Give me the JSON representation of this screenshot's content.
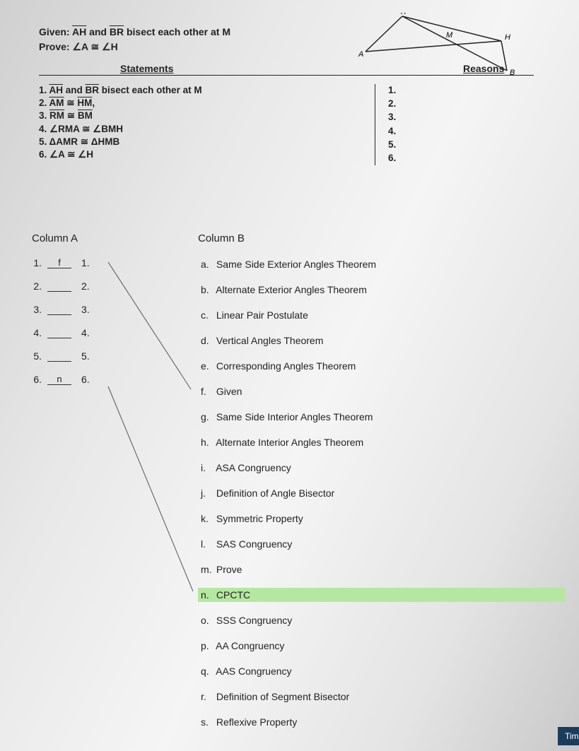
{
  "given_label": "Given:",
  "given_text_prefix": " ",
  "given_ah": "AH",
  "given_and": " and ",
  "given_br": "BR",
  "given_rest": " bisect each other at M",
  "prove_label": "Prove:",
  "prove_text": " ∠A ≅ ∠H",
  "diagram": {
    "R": "R",
    "A": "A",
    "M": "M",
    "H": "H",
    "B": "B"
  },
  "headers": {
    "statements": "Statements",
    "reasons": "Reasons"
  },
  "statements": [
    {
      "n": "1.",
      "pre": "",
      "seg1": "AH",
      "mid": " and ",
      "seg2": "BR",
      "post": " bisect each other at M"
    },
    {
      "n": "2.",
      "pre": "",
      "seg1": "AM",
      "mid": " ≅ ",
      "seg2": "HM",
      "post": ","
    },
    {
      "n": "3.",
      "pre": "",
      "seg1": "RM",
      "mid": " ≅ ",
      "seg2": "BM",
      "post": ""
    },
    {
      "n": "4.",
      "pre": "∠RMA ≅ ∠BMH",
      "seg1": "",
      "mid": "",
      "seg2": "",
      "post": ""
    },
    {
      "n": "5.",
      "pre": "ΔAMR ≅ ΔHMB",
      "seg1": "",
      "mid": "",
      "seg2": "",
      "post": ""
    },
    {
      "n": "6.",
      "pre": "∠A ≅ ∠H",
      "seg1": "",
      "mid": "",
      "seg2": "",
      "post": ""
    }
  ],
  "reasons_nums": [
    "1.",
    "2.",
    "3.",
    "4.",
    "5.",
    "6."
  ],
  "columnA": {
    "title": "Column A",
    "rows": [
      {
        "n": "1.",
        "ans": "f",
        "n2": "1."
      },
      {
        "n": "2.",
        "ans": "",
        "n2": "2."
      },
      {
        "n": "3.",
        "ans": "",
        "n2": "3."
      },
      {
        "n": "4.",
        "ans": "",
        "n2": "4."
      },
      {
        "n": "5.",
        "ans": "",
        "n2": "5."
      },
      {
        "n": "6.",
        "ans": "n",
        "n2": "6."
      }
    ]
  },
  "columnB": {
    "title": "Column B",
    "items": [
      {
        "l": "a.",
        "t": "Same Side Exterior Angles Theorem",
        "hl": false
      },
      {
        "l": "b.",
        "t": "Alternate Exterior Angles Theorem",
        "hl": false
      },
      {
        "l": "c.",
        "t": "Linear Pair Postulate",
        "hl": false
      },
      {
        "l": "d.",
        "t": "Vertical Angles Theorem",
        "hl": false
      },
      {
        "l": "e.",
        "t": "Corresponding Angles Theorem",
        "hl": false
      },
      {
        "l": "f.",
        "t": "Given",
        "hl": false
      },
      {
        "l": "g.",
        "t": "Same Side Interior Angles Theorem",
        "hl": false
      },
      {
        "l": "h.",
        "t": "Alternate Interior Angles Theorem",
        "hl": false
      },
      {
        "l": "i.",
        "t": "ASA Congruency",
        "hl": false
      },
      {
        "l": "j.",
        "t": "Definition of Angle Bisector",
        "hl": false
      },
      {
        "l": "k.",
        "t": "Symmetric Property",
        "hl": false
      },
      {
        "l": "l.",
        "t": "SAS Congruency",
        "hl": false
      },
      {
        "l": "m.",
        "t": "Prove",
        "hl": false
      },
      {
        "l": "n.",
        "t": "CPCTC",
        "hl": true
      },
      {
        "l": "o.",
        "t": "SSS Congruency",
        "hl": false
      },
      {
        "l": "p.",
        "t": "AA Congruency",
        "hl": false
      },
      {
        "l": "q.",
        "t": "AAS Congruency",
        "hl": false
      },
      {
        "l": "r.",
        "t": "Definition of Segment Bisector",
        "hl": false
      },
      {
        "l": "s.",
        "t": "Reflexive Property",
        "hl": false
      }
    ]
  },
  "badge": "Tim"
}
